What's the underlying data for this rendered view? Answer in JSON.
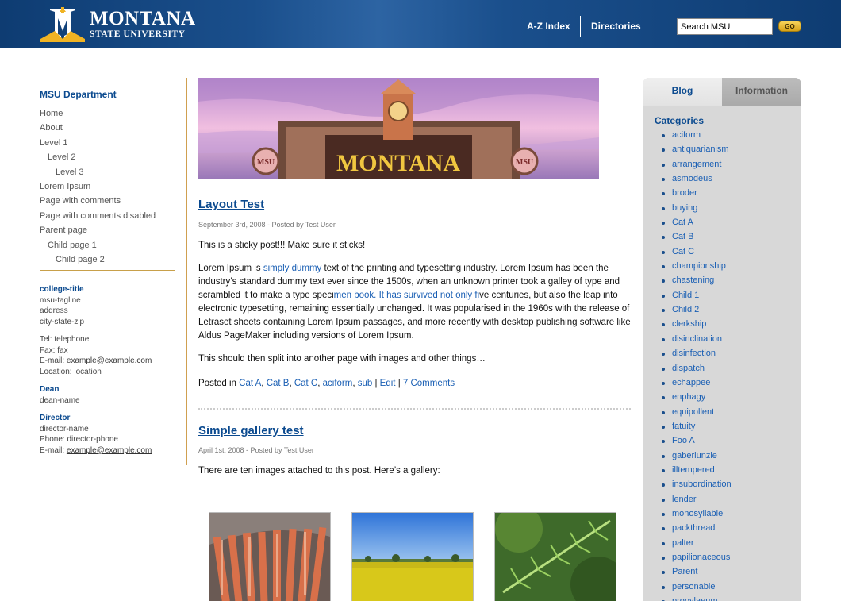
{
  "header": {
    "logo_line1": "MONTANA",
    "logo_line2": "STATE UNIVERSITY",
    "nav": [
      "A-Z Index",
      "Directories"
    ],
    "search_value": "Search MSU",
    "go_label": "GO"
  },
  "sidebar": {
    "title": "MSU Department",
    "items": [
      {
        "label": "Home",
        "level": 0
      },
      {
        "label": "About",
        "level": 0
      },
      {
        "label": "Level 1",
        "level": 0
      },
      {
        "label": "Level 2",
        "level": 1
      },
      {
        "label": "Level 3",
        "level": 2
      },
      {
        "label": "Lorem Ipsum",
        "level": 0
      },
      {
        "label": "Page with comments",
        "level": 0
      },
      {
        "label": "Page with comments disabled",
        "level": 0
      },
      {
        "label": "Parent page",
        "level": 0
      },
      {
        "label": "Child page 1",
        "level": 1
      },
      {
        "label": "Child page 2",
        "level": 2
      }
    ],
    "college_title": "college-title",
    "tagline": "msu-tagline",
    "address": "address",
    "city_state_zip": "city-state-zip",
    "tel": "Tel: telephone",
    "fax": "Fax: fax",
    "email_label": "E-mail: ",
    "email": "example@example.com",
    "location": "Location: location",
    "dean_heading": "Dean",
    "dean_name": "dean-name",
    "director_heading": "Director",
    "director_name": "director-name",
    "director_phone": "Phone: director-phone",
    "director_email_label": "E-mail: ",
    "director_email": "example@example.com"
  },
  "banner": {
    "sign_text": "MONTANA",
    "emblem_letters": "MSU"
  },
  "posts": [
    {
      "title": "Layout Test",
      "meta": "September 3rd, 2008 - Posted by Test User",
      "sticky": "This is a sticky post!!! Make sure it sticks!",
      "body_a": "Lorem Ipsum is ",
      "link1": "simply dummy",
      "body_b": " text of the printing and typesetting industry. Lorem Ipsum has been the industry’s standard dummy text ever since the 1500s, when an unknown printer took a galley of type and scrambled it to make a type speci",
      "link2": "men book. It has survived not only fi",
      "body_c": "ve centuries, but also the leap into electronic typesetting, remaining essentially unchanged. It was popularised in the 1960s with the release of Letraset sheets containing Lorem Ipsum passages, and more recently with desktop publishing software like Aldus PageMaker including versions of Lorem Ipsum.",
      "split": "This should then split into another page with images and other things…",
      "posted_in": "Posted in ",
      "categories": [
        "Cat A",
        "Cat B",
        "Cat C",
        "aciform",
        "sub"
      ],
      "edit": "Edit",
      "comments": "7 Comments"
    },
    {
      "title": "Simple gallery test",
      "meta": "April 1st, 2008 - Posted by Test User",
      "intro": "There are ten images attached to this post.  Here’s a gallery:"
    }
  ],
  "right": {
    "tabs": [
      "Blog",
      "Information"
    ],
    "categories_title": "Categories",
    "categories": [
      "aciform",
      "antiquarianism",
      "arrangement",
      "asmodeus",
      "broder",
      "buying",
      "Cat A",
      "Cat B",
      "Cat C",
      "championship",
      "chastening",
      "Child 1",
      "Child 2",
      "clerkship",
      "disinclination",
      "disinfection",
      "dispatch",
      "echappee",
      "enphagy",
      "equipollent",
      "fatuity",
      "Foo A",
      "gaberlunzie",
      "illtempered",
      "insubordination",
      "lender",
      "monosyllable",
      "packthread",
      "palter",
      "papilionaceous",
      "Parent",
      "personable",
      "propylaeum"
    ]
  },
  "colors": {
    "header_blue": "#0e3c72",
    "link_blue": "#1a5fb4",
    "heading_blue": "#0b4a8f",
    "gold": "#f0b323"
  }
}
